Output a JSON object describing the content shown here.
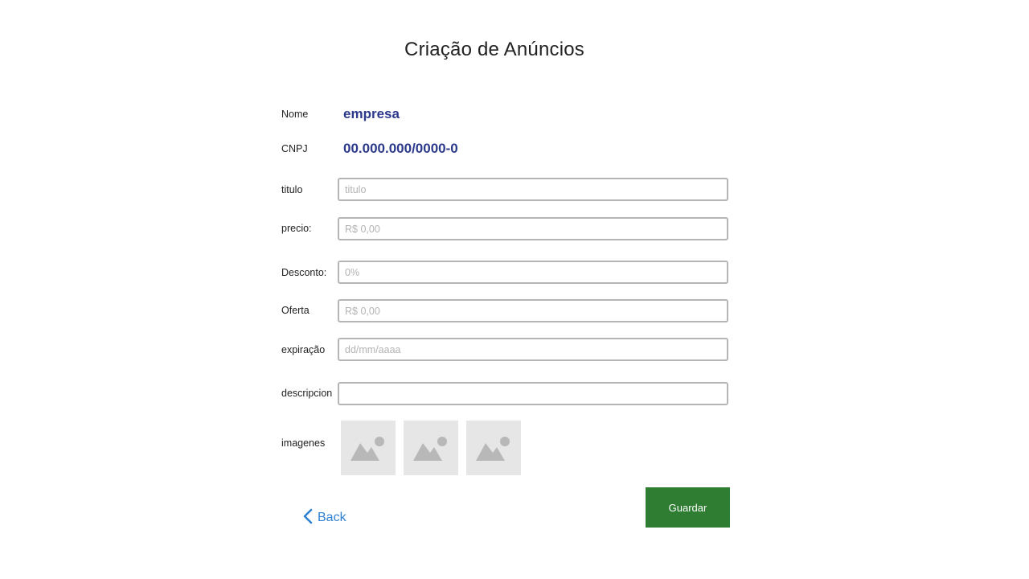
{
  "page": {
    "title": "Criação de Anúncios"
  },
  "company": {
    "name_label": "Nome",
    "name_value": "empresa",
    "cnpj_label": "CNPJ",
    "cnpj_value": "00.000.000/0000-0"
  },
  "form": {
    "titulo": {
      "label": "titulo",
      "placeholder": "titulo",
      "value": ""
    },
    "precio": {
      "label": "precio:",
      "placeholder": "R$ 0,00",
      "value": ""
    },
    "desconto": {
      "label": "Desconto:",
      "placeholder": "0%",
      "value": ""
    },
    "oferta": {
      "label": "Oferta",
      "placeholder": "R$ 0,00",
      "value": ""
    },
    "expiracao": {
      "label": "expiração",
      "placeholder": "dd/mm/aaaa",
      "value": ""
    },
    "descripcion": {
      "label": "descripcion",
      "placeholder": "",
      "value": ""
    },
    "imagenes": {
      "label": "imagenes",
      "slots": [
        "image-placeholder-icon",
        "image-placeholder-icon",
        "image-placeholder-icon"
      ]
    }
  },
  "actions": {
    "back_label": "Back",
    "save_label": "Guardar"
  },
  "colors": {
    "accent_text": "#2c3a8c",
    "link": "#2f80d1",
    "save_button": "#2e7d32",
    "image_slot_bg": "#e6e6e6",
    "image_icon": "#b8b8b8"
  }
}
